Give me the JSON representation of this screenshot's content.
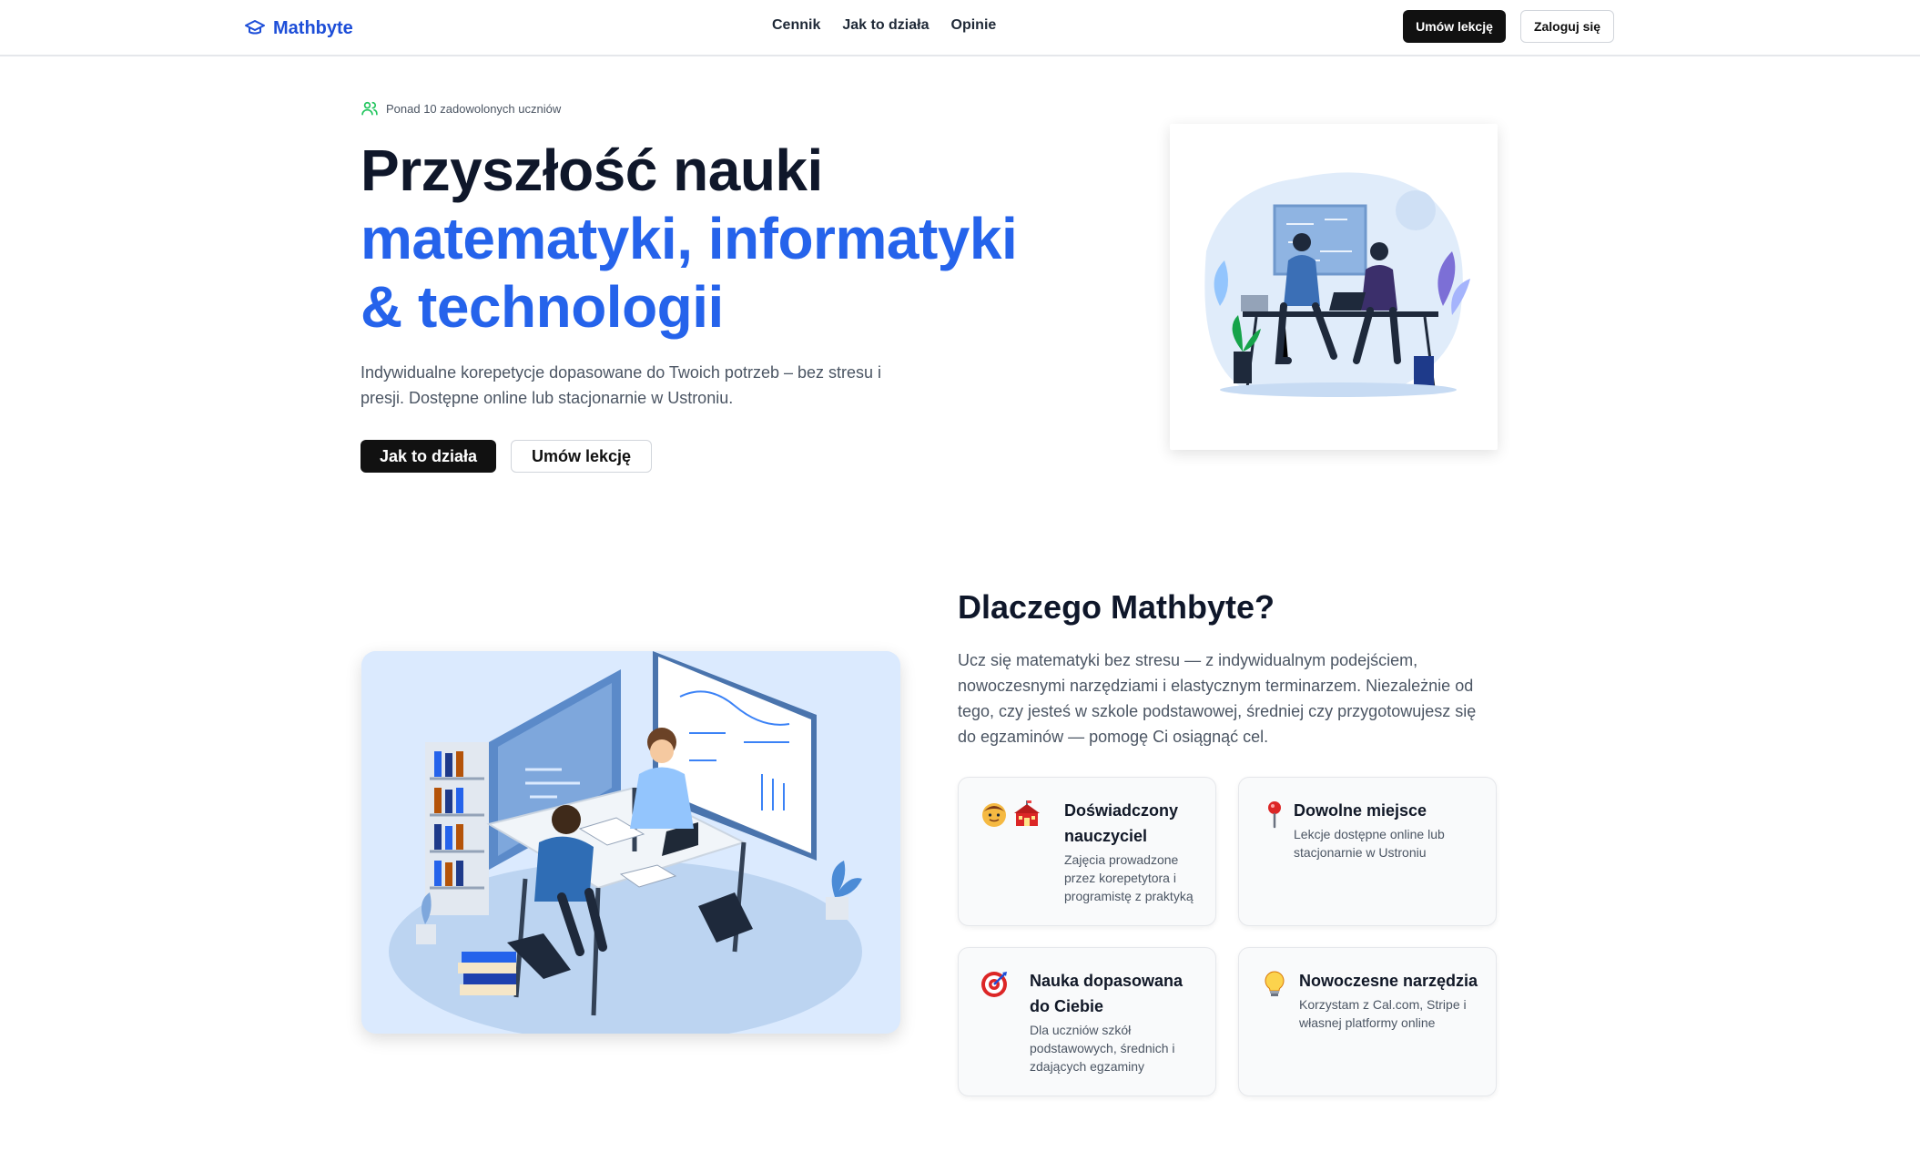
{
  "nav": {
    "brand": "Mathbyte",
    "links": [
      "Cennik",
      "Jak to działa",
      "Opinie"
    ],
    "cta_primary": "Umów lekcję",
    "cta_login": "Zaloguj się"
  },
  "hero": {
    "badge": "Ponad 10 zadowolonych uczniów",
    "title_line1": "Przyszłość nauki",
    "title_line2": "matematyki, informatyki",
    "title_line3": "& technologii",
    "subtitle": "Indywidualne korepetycje dopasowane do Twoich potrzeb – bez stresu i presji. Dostępne online lub stacjonarnie w Ustroniu.",
    "btn_primary": "Jak to działa",
    "btn_secondary": "Umów lekcję"
  },
  "why": {
    "title": "Dlaczego Mathbyte?",
    "text": "Ucz się matematyki bez stresu — z indywidualnym podejściem, nowoczesnymi narzędziami i elastycznym terminarzem. Niezależnie od tego, czy jesteś w szkole podstawowej, średniej czy przygotowujesz się do egzaminów — pomogę Ci osiągnąć cel.",
    "features": [
      {
        "title": "Doświadczony nauczyciel",
        "desc": "Zajęcia prowadzone przez korepetytora i programistę z praktyką",
        "icons": [
          "teacher-face-icon",
          "school-icon"
        ]
      },
      {
        "title": "Dowolne miejsce",
        "desc": "Lekcje dostępne online lub stacjonarnie w Ustroniu",
        "icons": [
          "pin-icon"
        ]
      },
      {
        "title": "Nauka dopasowana do Ciebie",
        "desc": "Dla uczniów szkół podstawowych, średnich i zdających egzaminy",
        "icons": [
          "target-icon"
        ]
      },
      {
        "title": "Nowoczesne narzędzia",
        "desc": "Korzystam z Cal.com, Stripe i własnej platformy online",
        "icons": [
          "lightbulb-icon"
        ]
      }
    ]
  },
  "colors": {
    "brand_blue": "#2563eb",
    "dark": "#111111",
    "text_muted": "#4b5563"
  }
}
